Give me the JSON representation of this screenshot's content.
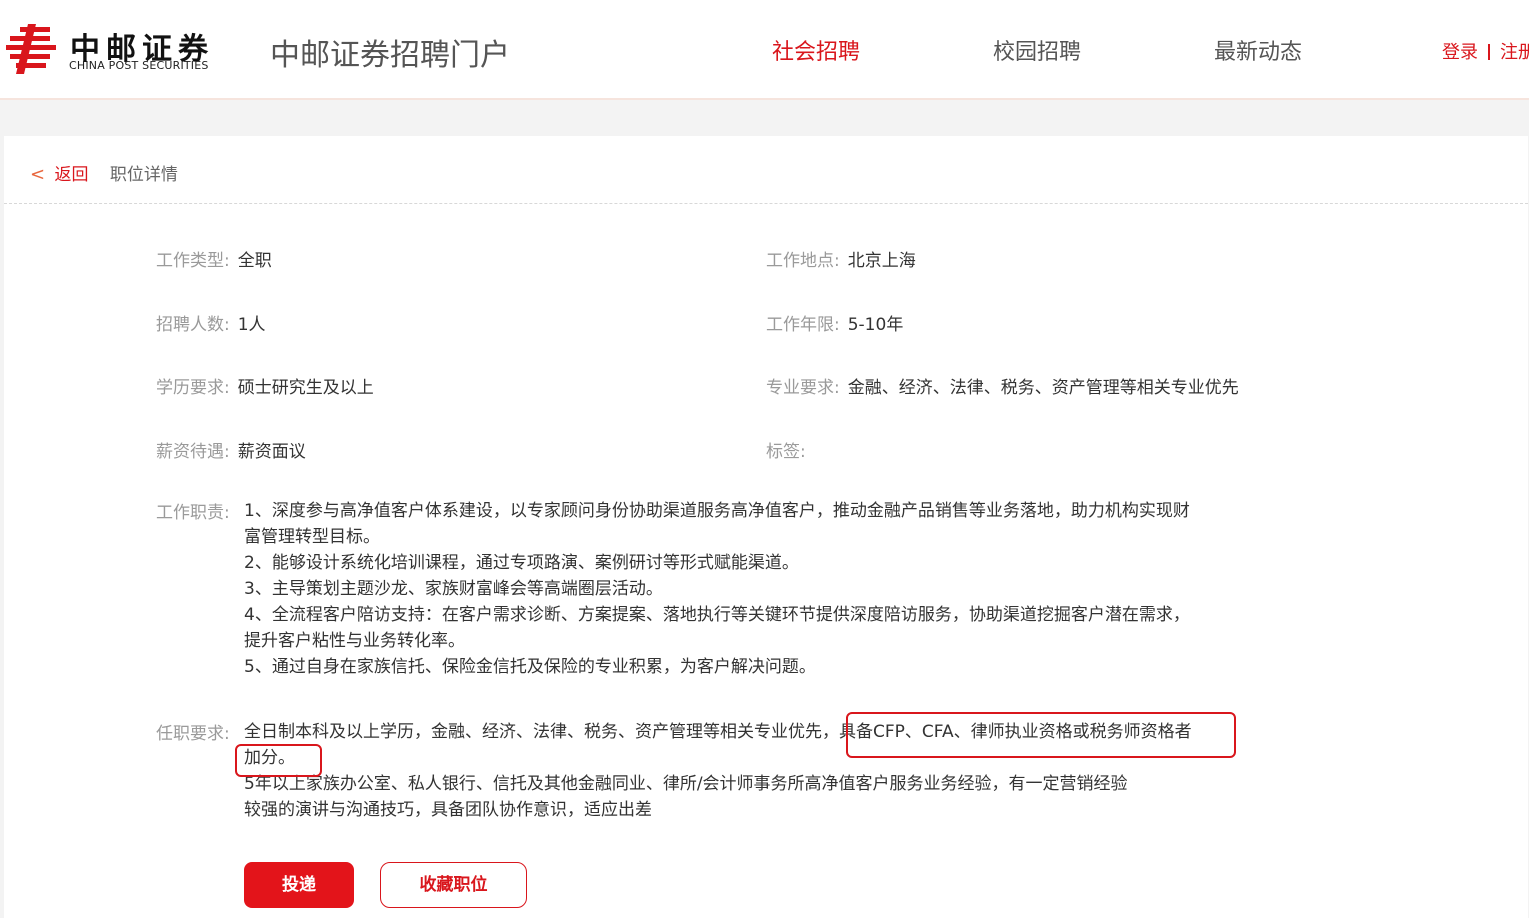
{
  "brand": {
    "name_cn": "中邮证券",
    "name_en": "CHINA POST SECURITIES",
    "portal_title": "中邮证券招聘门户",
    "accent_color": "#d9161c"
  },
  "nav": {
    "items": [
      {
        "label": "社会招聘",
        "active": true
      },
      {
        "label": "校园招聘",
        "active": false
      },
      {
        "label": "最新动态",
        "active": false
      }
    ],
    "login": "登录",
    "register": "注册"
  },
  "breadcrumb": {
    "back_label": "返回",
    "current": "职位详情",
    "back_icon": "chevron-left-icon"
  },
  "job": {
    "type": {
      "label": "工作类型:",
      "value": "全职"
    },
    "location": {
      "label": "工作地点:",
      "value": "北京上海"
    },
    "headcount": {
      "label": "招聘人数:",
      "value": "1人"
    },
    "experience": {
      "label": "工作年限:",
      "value": "5-10年"
    },
    "education": {
      "label": "学历要求:",
      "value": "硕士研究生及以上"
    },
    "major": {
      "label": "专业要求:",
      "value": "金融、经济、法律、税务、资产管理等相关专业优先"
    },
    "salary": {
      "label": "薪资待遇:",
      "value": "薪资面议"
    },
    "tags": {
      "label": "标签:",
      "value": ""
    },
    "duties": {
      "label": "工作职责:",
      "lines": [
        "1、深度参与高净值客户体系建设，以专家顾问身份协助渠道服务高净值客户，推动金融产品销售等业务落地，助力机构实现财",
        "富管理转型目标。",
        "2、能够设计系统化培训课程，通过专项路演、案例研讨等形式赋能渠道。",
        "3、主导策划主题沙龙、家族财富峰会等高端圈层活动。",
        "4、全流程客户陪访支持：在客户需求诊断、方案提案、落地执行等关键环节提供深度陪访服务，协助渠道挖掘客户潜在需求，",
        "提升客户粘性与业务转化率。",
        "5、通过自身在家族信托、保险金信托及保险的专业积累，为客户解决问题。"
      ]
    },
    "requirements": {
      "label": "任职要求:",
      "lines": [
        "全日制本科及以上学历，金融、经济、法律、税务、资产管理等相关专业优先，具备CFP、CFA、律师执业资格或税务师资格者",
        "加分。",
        "5年以上家族办公室、私人银行、信托及其他金融同业、律所/会计师事务所高净值客户服务业务经验，有一定营销经验",
        "较强的演讲与沟通技巧，具备团队协作意识，适应出差"
      ]
    }
  },
  "actions": {
    "apply": "投递",
    "favorite": "收藏职位"
  }
}
